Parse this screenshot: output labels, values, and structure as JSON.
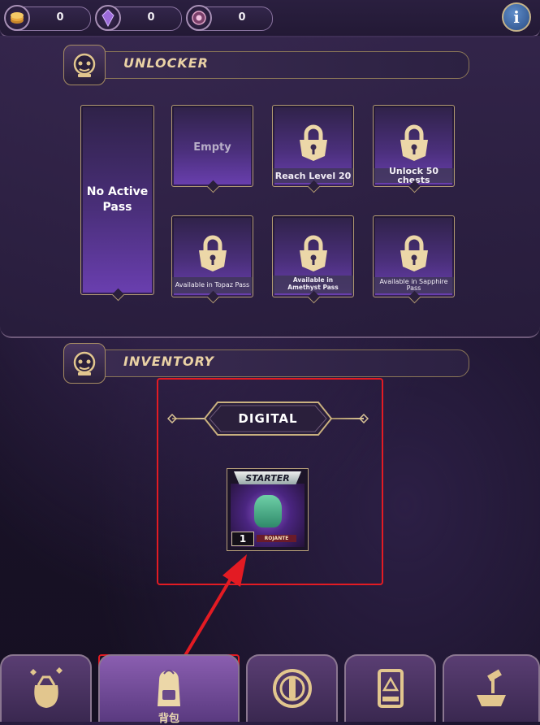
{
  "currencies": [
    {
      "name": "gold-coin",
      "value": "0"
    },
    {
      "name": "amethyst-crystal",
      "value": "0"
    },
    {
      "name": "gem-token",
      "value": "0"
    }
  ],
  "info_button": {
    "label": "i"
  },
  "unlocker": {
    "title": "UNLOCKER",
    "no_pass_label": "No Active Pass",
    "slots": [
      {
        "label": "Empty",
        "locked": false
      },
      {
        "label": "Reach Level 20",
        "locked": true
      },
      {
        "label": "Unlock 50 chests",
        "locked": true
      },
      {
        "label": "Available in Topaz Pass",
        "locked": true
      },
      {
        "label": "Available in Amethyst Pass",
        "locked": true
      },
      {
        "label": "Available in Sapphire Pass",
        "locked": true
      }
    ]
  },
  "inventory": {
    "title": "INVENTORY",
    "filter_label": "DIGITAL",
    "items": [
      {
        "card_header": "STARTER",
        "quantity": "1",
        "card_name": "ROJANTE"
      }
    ]
  },
  "nav": {
    "items": [
      {
        "name": "loot-bag",
        "label": ""
      },
      {
        "name": "backpack",
        "label": "背包",
        "active": true
      },
      {
        "name": "portal",
        "label": ""
      },
      {
        "name": "card-frame",
        "label": ""
      },
      {
        "name": "forge",
        "label": ""
      }
    ]
  },
  "colors": {
    "accent_gold": "#d8b98a",
    "highlight_red": "#e31b23",
    "panel_purple": "#3b2c52"
  }
}
